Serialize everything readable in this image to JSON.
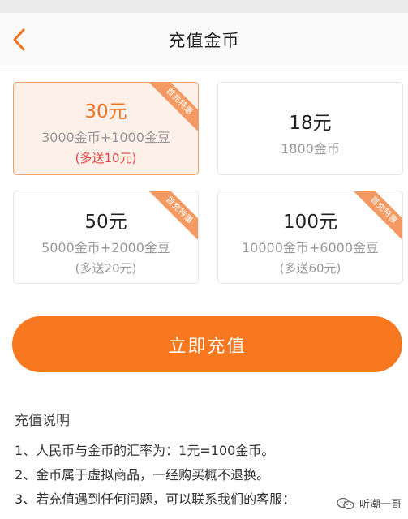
{
  "nav": {
    "title": "充值金币"
  },
  "packages": [
    {
      "price": "30元",
      "desc": "3000金币+1000金豆",
      "bonus": "(多送10元)",
      "tag": "首充特惠"
    },
    {
      "price": "18元",
      "desc": "1800金币",
      "bonus": "",
      "tag": ""
    },
    {
      "price": "50元",
      "desc": "5000金币+2000金豆",
      "bonus": "(多送20元)",
      "tag": "首充特惠"
    },
    {
      "price": "100元",
      "desc": "10000金币+6000金豆",
      "bonus": "(多送60元)",
      "tag": "首充特惠"
    }
  ],
  "selected_index": 0,
  "cta": {
    "label": "立即充值"
  },
  "notes": {
    "title": "充值说明",
    "items": [
      "1、人民币与金币的汇率为：1元=100金币。",
      "2、金币属于虚拟商品，一经购买概不退换。",
      "3、若充值遇到任何问题，可以联系我们的客服："
    ]
  },
  "watermark": {
    "text": "听潮一哥",
    "icon": "wechat-icon"
  },
  "colors": {
    "accent": "#f7781e",
    "selected_bg": "#fdf0e8",
    "bonus_red": "#e54242",
    "ribbon": "#f39a62"
  }
}
